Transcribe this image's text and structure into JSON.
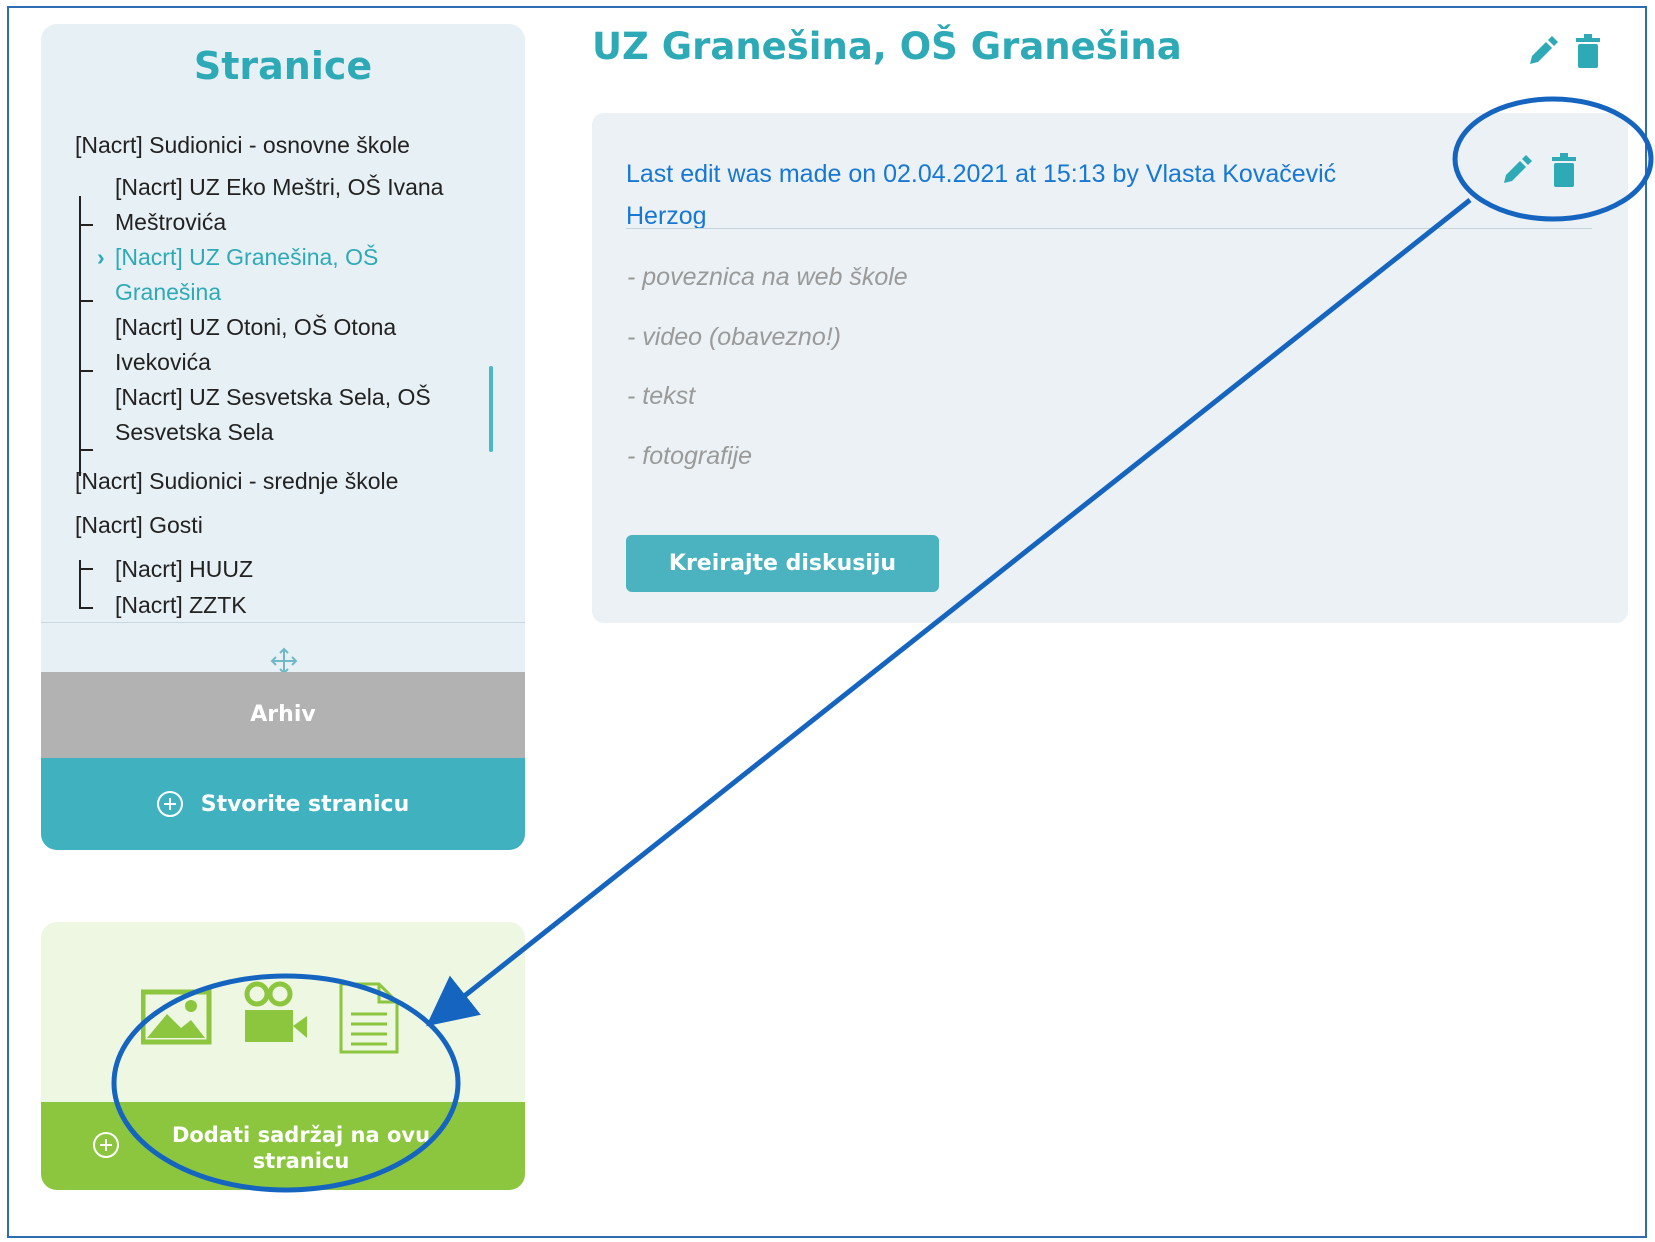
{
  "sidebar": {
    "title": "Stranice",
    "items": [
      {
        "label": "[Nacrt] Sudionici - osnovne škole"
      },
      {
        "label_line1": "[Nacrt] UZ Eko Meštri, OŠ Ivana",
        "label_line2": "Meštrovića"
      },
      {
        "label_line1": "[Nacrt] UZ Granešina, OŠ",
        "label_line2": "Granešina"
      },
      {
        "label_line1": "[Nacrt] UZ Otoni, OŠ Otona",
        "label_line2": "Ivekovića"
      },
      {
        "label_line1": "[Nacrt] UZ Sesvetska Sela, OŠ",
        "label_line2": "Sesvetska Sela"
      },
      {
        "label": "[Nacrt] Sudionici - srednje škole"
      },
      {
        "label": "[Nacrt] Gosti"
      },
      {
        "label": "[Nacrt] HUUZ"
      },
      {
        "label": "[Nacrt] ZZTK"
      }
    ],
    "archive_label": "Arhiv",
    "create_page_label": "Stvorite stranicu"
  },
  "add_content": {
    "button_line1": "Dodati sadržaj na ovu",
    "button_line2": "stranicu",
    "icons": [
      "image-icon",
      "video-camera-icon",
      "document-icon"
    ]
  },
  "page": {
    "title": "UZ Granešina, OŠ Granešina"
  },
  "card": {
    "last_edit_line1": "Last edit was made on 02.04.2021 at 15:13 by Vlasta Kovačević",
    "last_edit_line2": "Herzog",
    "items": [
      "- poveznica na web škole",
      "- video (obavezno!)",
      "- tekst",
      "- fotografije"
    ],
    "discussion_button": "Kreirajte diskusiju"
  },
  "colors": {
    "teal": "#2eaab7",
    "link_blue": "#1778d4",
    "annotation_blue": "#1565c0",
    "green": "#8cc63f",
    "gray": "#b2b2b2"
  }
}
